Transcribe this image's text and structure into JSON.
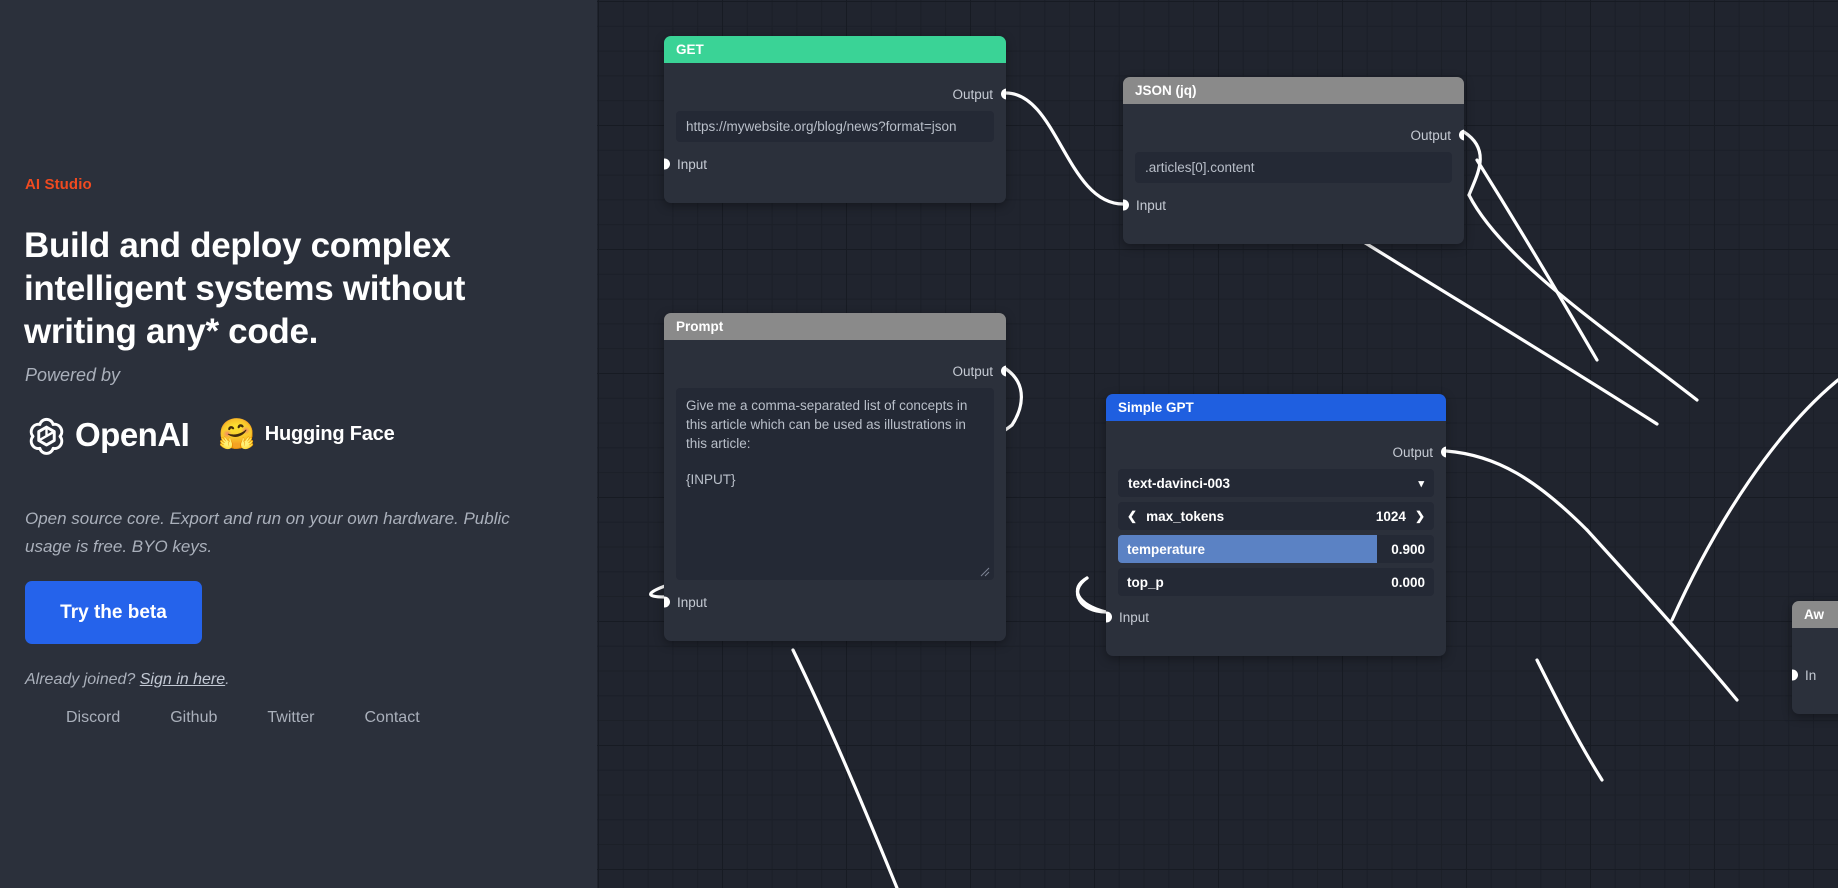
{
  "left": {
    "brand": "AI Studio",
    "headline": "Build and deploy complex intelligent systems without writing any* code.",
    "powered_by": "Powered by",
    "logos": [
      {
        "name": "OpenAI",
        "icon": "openai-logo"
      },
      {
        "name": "Hugging Face",
        "icon": "hugging-face-logo",
        "glyph": "🤗"
      }
    ],
    "tagline": "Open source core. Export and run on your own hardware. Public usage is free. BYO keys.",
    "cta_label": "Try the beta",
    "signin_prefix": "Already joined? ",
    "signin_link": "Sign in here",
    "signin_suffix": ".",
    "footer_links": [
      "Discord",
      "Github",
      "Twitter",
      "Contact"
    ],
    "colors": {
      "brand": "#f04a20",
      "cta": "#2563eb",
      "panel_bg": "#2b303b",
      "muted_text": "#aab0bb"
    }
  },
  "canvas": {
    "nodes": [
      {
        "title": "GET",
        "header_color": "#3ad396",
        "output_label": "Output",
        "input_label": "Input",
        "url_value": "https://mywebsite.org/blog/news?format=json"
      },
      {
        "title": "JSON (jq)",
        "header_color": "#8a8a8a",
        "output_label": "Output",
        "input_label": "Input",
        "query_value": ".articles[0].content"
      },
      {
        "title": "Prompt",
        "header_color": "#8a8a8a",
        "output_label": "Output",
        "input_label": "Input",
        "prompt_line1": "Give me a comma-separated list of concepts in this article which can be used as illustrations in this article:",
        "prompt_line2": "{INPUT}"
      },
      {
        "title": "Simple GPT",
        "header_color": "#1f5fe0",
        "output_label": "Output",
        "input_label": "Input",
        "model": "text-davinci-003",
        "params": [
          {
            "name": "max_tokens",
            "value": "1024",
            "fill_pct": 0,
            "highlight": false
          },
          {
            "name": "temperature",
            "value": "0.900",
            "fill_pct": 82,
            "highlight": true
          },
          {
            "name": "top_p",
            "value": "0.000",
            "fill_pct": 0,
            "highlight": false
          }
        ]
      },
      {
        "title": "Aw",
        "header_color": "#8a8a8a",
        "input_label": "In"
      }
    ]
  }
}
